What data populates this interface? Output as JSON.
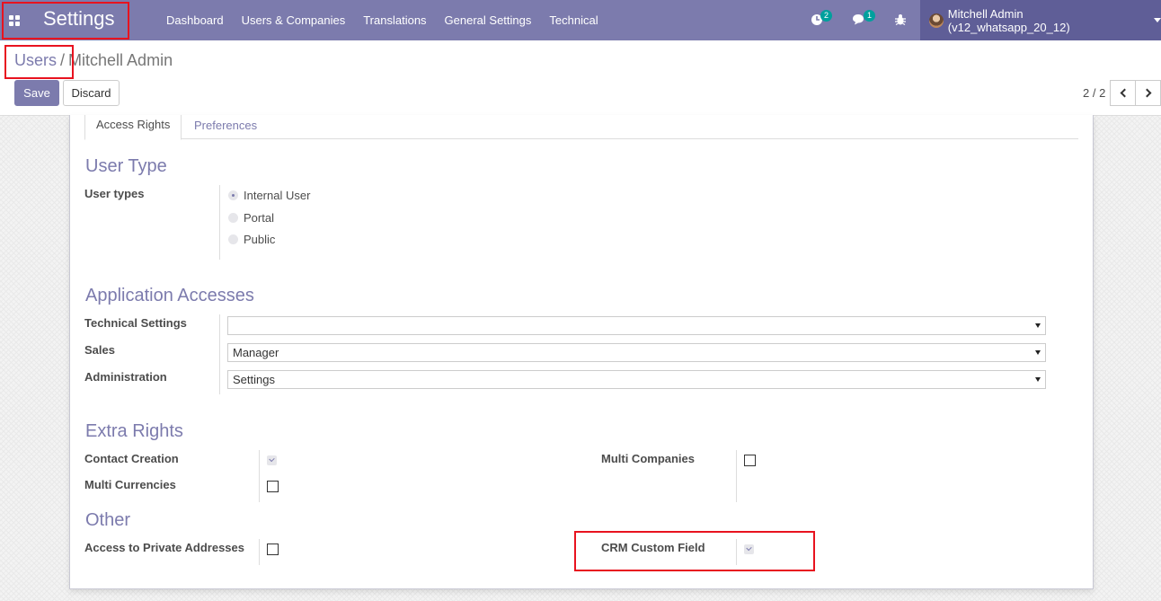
{
  "navbar": {
    "app_title": "Settings",
    "apps_icon": "apps-grid-icon",
    "menu": [
      "Dashboard",
      "Users & Companies",
      "Translations",
      "General Settings",
      "Technical"
    ],
    "activities_count": "2",
    "messages_count": "1",
    "user_name": "Mitchell Admin (v12_whatsapp_20_12)"
  },
  "breadcrumb": {
    "parent": "Users",
    "separator": "/",
    "current": "Mitchell Admin"
  },
  "buttons": {
    "save": "Save",
    "discard": "Discard"
  },
  "pager": {
    "value": "2 / 2"
  },
  "tabs": [
    "Access Rights",
    "Preferences"
  ],
  "user_type": {
    "title": "User Type",
    "label": "User types",
    "options": [
      "Internal User",
      "Portal",
      "Public"
    ],
    "selected": "Internal User"
  },
  "app_access": {
    "title": "Application Accesses",
    "fields": [
      {
        "label": "Technical Settings",
        "value": ""
      },
      {
        "label": "Sales",
        "value": "Manager"
      },
      {
        "label": "Administration",
        "value": "Settings"
      }
    ]
  },
  "extra_rights": {
    "title": "Extra Rights",
    "contact_creation": {
      "label": "Contact Creation",
      "checked": true,
      "readonly": true
    },
    "multi_currencies": {
      "label": "Multi Currencies",
      "checked": false
    },
    "multi_companies": {
      "label": "Multi Companies",
      "checked": false
    }
  },
  "other": {
    "title": "Other",
    "private_addresses": {
      "label": "Access to Private Addresses",
      "checked": false
    },
    "crm_custom_field": {
      "label": "CRM Custom Field",
      "checked": true,
      "readonly": true
    }
  },
  "colors": {
    "brand": "#7c7bad",
    "brand_dark": "#5f5e97",
    "badge": "#00a09d",
    "highlight": "#e8131f"
  }
}
